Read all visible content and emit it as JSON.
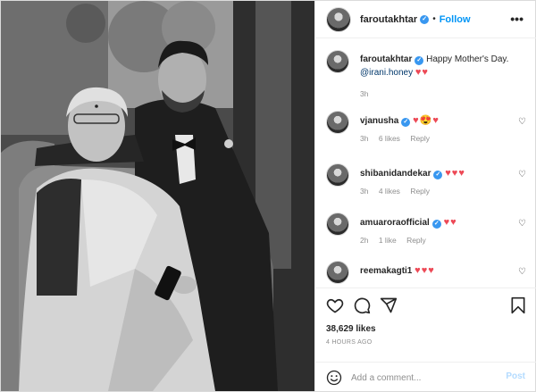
{
  "post": {
    "author": "faroutakhtar",
    "follow_label": "Follow",
    "more_icon": "•••",
    "caption": {
      "user": "faroutakhtar",
      "text": "Happy Mother's Day.",
      "mention": "@irani.honey",
      "hearts": "♥♥",
      "time": "3h"
    },
    "comments": [
      {
        "user": "vjanusha",
        "text": "♥😍♥",
        "time": "3h",
        "likes": "6 likes",
        "reply": "Reply",
        "verified": true
      },
      {
        "user": "shibanidandekar",
        "text": "♥♥♥",
        "time": "3h",
        "likes": "4 likes",
        "reply": "Reply",
        "verified": true
      },
      {
        "user": "amuaroraofficial",
        "text": "♥♥",
        "time": "2h",
        "likes": "1 like",
        "reply": "Reply",
        "verified": true
      },
      {
        "user": "reemakagti1",
        "text": "♥♥♥",
        "time": "",
        "likes": "",
        "reply": "",
        "verified": false
      }
    ],
    "like_count": "38,629 likes",
    "posted_ago": "4 HOURS AGO",
    "comment_placeholder": "Add a comment...",
    "post_label": "Post"
  },
  "colors": {
    "follow": "#0095f6",
    "verified": "#3897f0",
    "heart": "#ed4956",
    "muted": "#8e8e8e"
  },
  "icons": [
    "verified-badge-icon",
    "more-options-icon",
    "heart-icon",
    "comment-icon",
    "share-icon",
    "bookmark-icon",
    "emoji-icon"
  ]
}
